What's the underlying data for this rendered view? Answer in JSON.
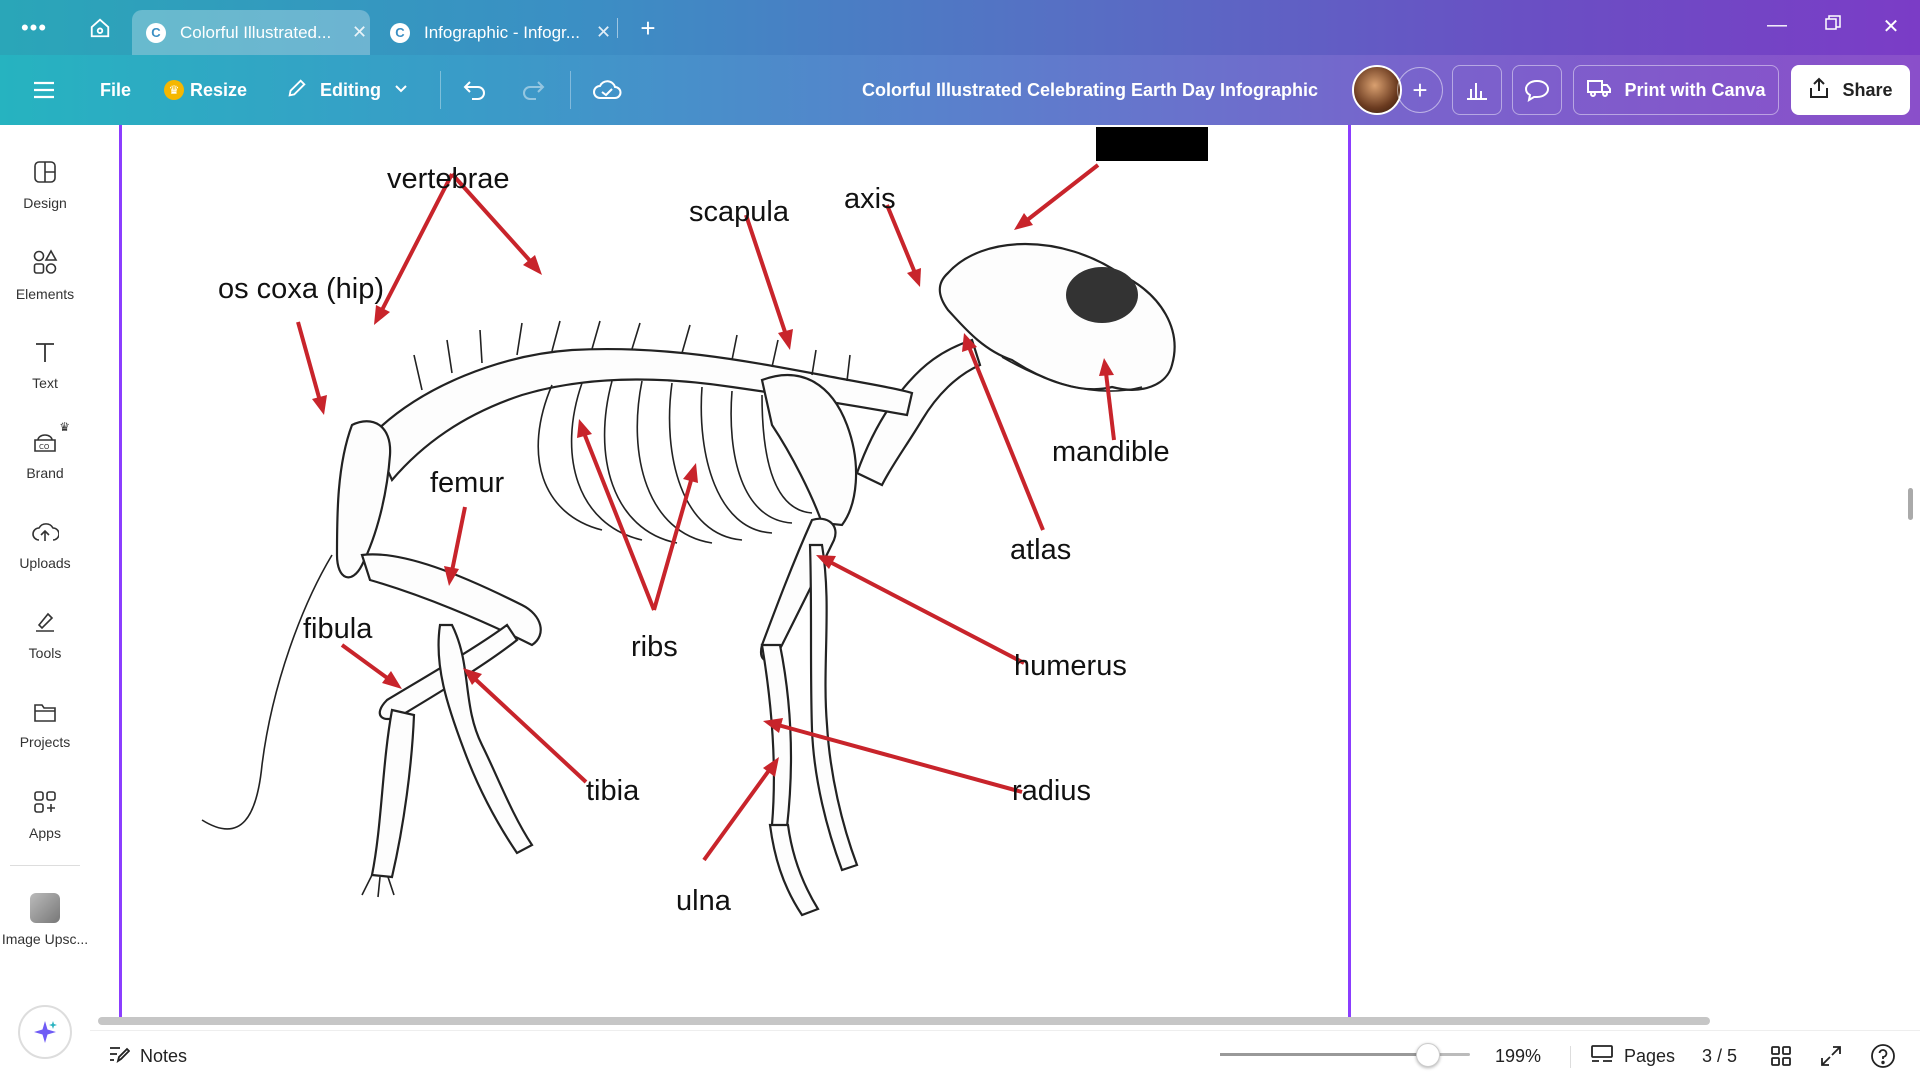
{
  "browser": {
    "tabs": [
      {
        "label": "Colorful Illustrated...",
        "active": true
      },
      {
        "label": "Infographic - Infogr...",
        "active": false
      }
    ]
  },
  "toolbar": {
    "file_label": "File",
    "resize_label": "Resize",
    "editing_label": "Editing",
    "doc_title": "Colorful Illustrated Celebrating Earth Day Infographic",
    "print_label": "Print with Canva",
    "share_label": "Share"
  },
  "sidebar": {
    "items": [
      {
        "label": "Design",
        "icon": "design-icon"
      },
      {
        "label": "Elements",
        "icon": "elements-icon"
      },
      {
        "label": "Text",
        "icon": "text-icon"
      },
      {
        "label": "Brand",
        "icon": "brand-icon"
      },
      {
        "label": "Uploads",
        "icon": "uploads-icon"
      },
      {
        "label": "Tools",
        "icon": "tools-icon"
      },
      {
        "label": "Projects",
        "icon": "projects-icon"
      },
      {
        "label": "Apps",
        "icon": "apps-icon"
      },
      {
        "label": "Image Upsc...",
        "icon": "image-upscaler-icon"
      }
    ]
  },
  "diagram": {
    "labels": {
      "vertebrae": "vertebrae",
      "scapula": "scapula",
      "axis": "axis",
      "os_coxa": "os coxa (hip)",
      "mandible": "mandible",
      "femur": "femur",
      "atlas": "atlas",
      "fibula": "fibula",
      "ribs": "ribs",
      "humerus": "humerus",
      "tibia": "tibia",
      "radius": "radius",
      "ulna": "ulna"
    },
    "arrow_color": "#c8242b"
  },
  "bottombar": {
    "notes_label": "Notes",
    "zoom": "199%",
    "zoom_level_fraction": 0.83,
    "pages_label": "Pages",
    "page_indicator": "3 / 5"
  },
  "colors": {
    "accent": "#8b3dff",
    "titlebar_gradient_start": "#2aa6b8",
    "titlebar_gradient_end": "#7b3cc6"
  }
}
